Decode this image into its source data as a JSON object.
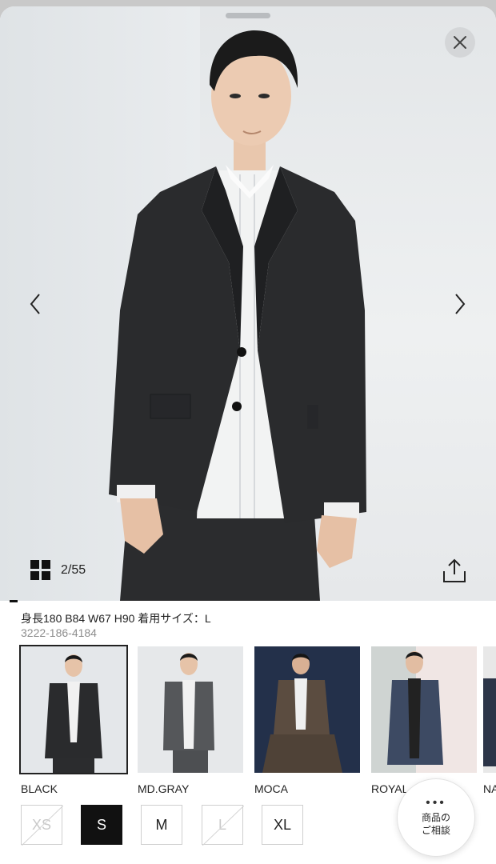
{
  "gallery": {
    "counter": "2/55"
  },
  "model_info": {
    "measurements": "身長180 B84 W67 H90 着用サイズ：L",
    "product_code": "3222-186-4184"
  },
  "colors": [
    {
      "label": "BLACK",
      "selected": true,
      "jacket": "#2a2b2d",
      "bg": "#e4e7ea"
    },
    {
      "label": "MD.GRAY",
      "selected": false,
      "jacket": "#55575a",
      "bg": "#e6e8ea"
    },
    {
      "label": "MOCA",
      "selected": false,
      "jacket": "#5b4c40",
      "bg": "#23304a"
    },
    {
      "label": "ROYAL",
      "selected": false,
      "jacket": "#3d4a63",
      "bg": "#f0e6e4"
    },
    {
      "label": "NA",
      "selected": false,
      "jacket": "#2c3548",
      "bg": "#e8e8e8"
    }
  ],
  "sizes": [
    {
      "label": "XS",
      "available": false,
      "selected": false
    },
    {
      "label": "S",
      "available": true,
      "selected": true
    },
    {
      "label": "M",
      "available": true,
      "selected": false
    },
    {
      "label": "L",
      "available": false,
      "selected": false
    },
    {
      "label": "XL",
      "available": true,
      "selected": false
    }
  ],
  "consult": {
    "dots": "•••",
    "line1": "商品の",
    "line2": "ご相談"
  },
  "icons": {
    "close": "close-icon",
    "prev": "chevron-left-icon",
    "next": "chevron-right-icon",
    "grid": "grid-icon",
    "share": "share-icon"
  }
}
